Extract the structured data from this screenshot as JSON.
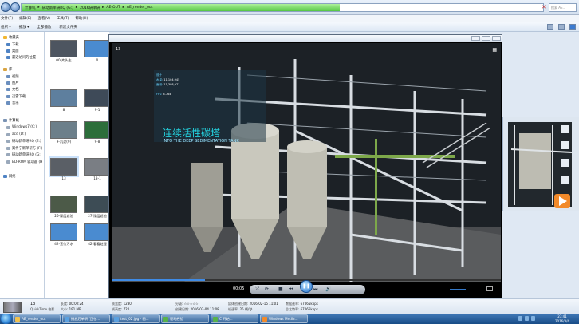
{
  "address": {
    "crumbs": [
      "计算机",
      "研动新单研RQ (G:)",
      "2016研单研",
      "AE-OUT",
      "AE_render_out"
    ],
    "search_placeholder": "搜索 AE...",
    "progress": 0.61
  },
  "menu": [
    "文件(F)",
    "编辑(E)",
    "查看(V)",
    "工具(T)",
    "帮助(H)"
  ],
  "toolbar": [
    "组织 ▾",
    "播放 ▾",
    "全部播放",
    "新建文件夹"
  ],
  "nav": {
    "items": [
      {
        "label": "收藏夹",
        "color": "#f2b631"
      },
      {
        "label": "下载",
        "color": "#4f83c4"
      },
      {
        "label": "桌面",
        "color": "#4f83c4"
      },
      {
        "label": "最近访问的位置",
        "color": "#4f83c4"
      },
      {
        "label": "库",
        "color": "#d9a441"
      },
      {
        "label": "视频",
        "color": "#6b8fbf"
      },
      {
        "label": "图片",
        "color": "#6b8fbf"
      },
      {
        "label": "文档",
        "color": "#6b8fbf"
      },
      {
        "label": "迅雷下载",
        "color": "#6b8fbf"
      },
      {
        "label": "音乐",
        "color": "#6b8fbf"
      },
      {
        "label": "计算机",
        "color": "#7a93b4"
      },
      {
        "label": "Windows7 (C:)",
        "color": "#9aa9bb"
      },
      {
        "label": "acd (D:)",
        "color": "#9aa9bb"
      },
      {
        "label": "研动新单研RQ (E:)",
        "color": "#9aa9bb"
      },
      {
        "label": "案件宁新单研方 (F:)",
        "color": "#9aa9bb"
      },
      {
        "label": "研动新单研RQ (G:)",
        "color": "#9aa9bb"
      },
      {
        "label": "BD-ROM 驱动器 (H",
        "color": "#9aa9bb"
      },
      {
        "label": "网络",
        "color": "#4f83c4"
      }
    ]
  },
  "files": [
    {
      "caption": "00-片头生",
      "color": "#4d5560"
    },
    {
      "caption": "0",
      "color": "#4a8bd0"
    },
    {
      "caption": "8",
      "color": "#5e7f9e"
    },
    {
      "caption": "9-1",
      "color": "#3e4a58"
    },
    {
      "caption": "9-沉淀(9)",
      "color": "#6c7f8a"
    },
    {
      "caption": "9-8",
      "color": "#2c6e3a"
    },
    {
      "caption": "13",
      "color": "#5a5f66"
    },
    {
      "caption": "13-1",
      "color": "#7a7e84"
    },
    {
      "caption": "26-深层滤池",
      "color": "#4c5a48"
    },
    {
      "caption": "27-深层滤池",
      "color": "#3d4c55"
    },
    {
      "caption": "42-宣传污水",
      "color": "#4a8bd0"
    },
    {
      "caption": "42-看看处理",
      "color": "#4a8bd0"
    }
  ],
  "player": {
    "video_name": "13",
    "info_lines": [
      {
        "label": "设计",
        "value": ""
      },
      {
        "label": "水量:",
        "value": "11,104,945"
      },
      {
        "label": "面积:",
        "value": "11,398,971"
      },
      {
        "label": "FFS:",
        "value": "4.764"
      }
    ],
    "overlay_cn": "连续活性碳塔",
    "overlay_en": "INTO THE DEEP SEDIMENTATION TANK",
    "time": "00:05",
    "seek_fraction": 0.24,
    "volume_fraction": 0.7,
    "play_icon": "pause-icon"
  },
  "details": {
    "name": "13",
    "type": "QuickTime 电影",
    "length_label": "长度:",
    "length": "00:00:24",
    "size_label": "大小:",
    "size": "191 MB",
    "width_label": "帧宽度:",
    "width": "1280",
    "height_label": "帧高度:",
    "height": "720",
    "rating_label": "分级:",
    "rating": "☆☆☆☆☆",
    "created_label": "创建日期:",
    "created": "2016-03-04 11:08",
    "media_created_label": "媒体创建日期:",
    "media_created": "2016-02-15 11:01",
    "framerate_label": "帧速率:",
    "framerate": "25 帧/秒",
    "datarate_label": "数据速率:",
    "datarate": "67065kbps",
    "bitrate_label": "总比特率:",
    "bitrate": "67065kbps"
  },
  "taskbar": {
    "tasks": [
      {
        "label": "AE_render_out",
        "color": "#f2c14e"
      },
      {
        "label": "播放后单研 [正在...",
        "color": "#5aa0e0"
      },
      {
        "label": "test_02.jpg - 画...",
        "color": "#5aa0e0"
      },
      {
        "label": "驱动经验",
        "color": "#58b24a"
      },
      {
        "label": "C 开始...",
        "color": "#58b24a"
      },
      {
        "label": "Windows Media...",
        "color": "#f28a2a"
      }
    ],
    "time": "23:41",
    "date": "2016/3/4"
  }
}
